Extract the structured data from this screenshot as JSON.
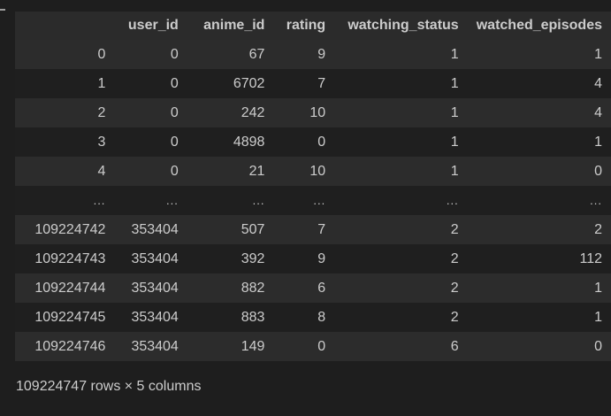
{
  "table": {
    "columns": [
      "",
      "user_id",
      "anime_id",
      "rating",
      "watching_status",
      "watched_episodes"
    ],
    "rows": [
      [
        "0",
        "0",
        "67",
        "9",
        "1",
        "1"
      ],
      [
        "1",
        "0",
        "6702",
        "7",
        "1",
        "4"
      ],
      [
        "2",
        "0",
        "242",
        "10",
        "1",
        "4"
      ],
      [
        "3",
        "0",
        "4898",
        "0",
        "1",
        "1"
      ],
      [
        "4",
        "0",
        "21",
        "10",
        "1",
        "0"
      ],
      [
        "...",
        "...",
        "...",
        "...",
        "...",
        "..."
      ],
      [
        "109224742",
        "353404",
        "507",
        "7",
        "2",
        "2"
      ],
      [
        "109224743",
        "353404",
        "392",
        "9",
        "2",
        "112"
      ],
      [
        "109224744",
        "353404",
        "882",
        "6",
        "2",
        "1"
      ],
      [
        "109224745",
        "353404",
        "883",
        "8",
        "2",
        "1"
      ],
      [
        "109224746",
        "353404",
        "149",
        "0",
        "6",
        "0"
      ]
    ]
  },
  "shape_note": "109224747 rows × 5 columns"
}
